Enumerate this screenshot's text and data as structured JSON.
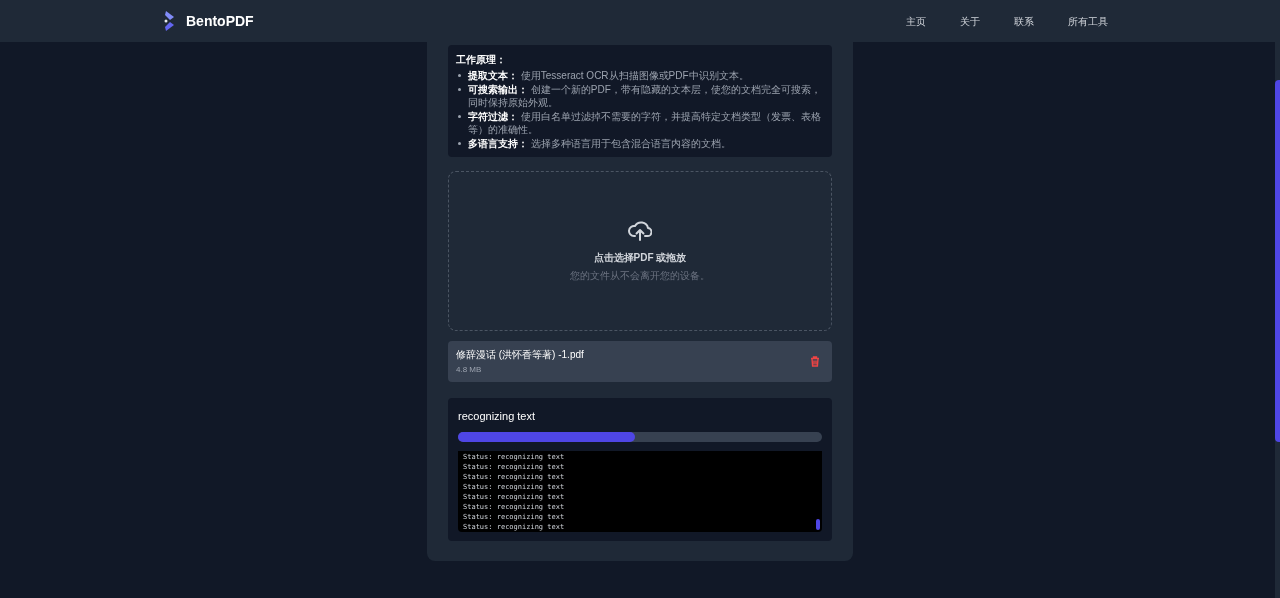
{
  "header": {
    "brand": "BentoPDF",
    "nav": [
      {
        "label": "主页"
      },
      {
        "label": "关于"
      },
      {
        "label": "联系"
      },
      {
        "label": "所有工具"
      }
    ]
  },
  "info": {
    "title": "工作原理：",
    "items": [
      {
        "term": "提取文本：",
        "text": "使用Tesseract OCR从扫描图像或PDF中识别文本。"
      },
      {
        "term": "可搜索输出：",
        "text": "创建一个新的PDF，带有隐藏的文本层，使您的文档完全可搜索，同时保持原始外观。"
      },
      {
        "term": "字符过滤：",
        "text": "使用白名单过滤掉不需要的字符，并提高特定文档类型（发票、表格等）的准确性。"
      },
      {
        "term": "多语言支持：",
        "text": "选择多种语言用于包含混合语言内容的文档。"
      }
    ]
  },
  "dropzone": {
    "title": "点击选择PDF 或拖放",
    "subtitle": "您的文件从不会离开您的设备。"
  },
  "file": {
    "name": "修辞漫话 (洪怀香等著) -1.pdf",
    "size": "4.8 MB"
  },
  "progress": {
    "status": "recognizing text",
    "level": 0.485,
    "log": [
      "Status: recognizing text",
      "Status: recognizing text",
      "Status: recognizing text",
      "Status: recognizing text",
      "Status: recognizing text",
      "Status: recognizing text",
      "Status: recognizing text",
      "Status: recognizing text"
    ]
  }
}
